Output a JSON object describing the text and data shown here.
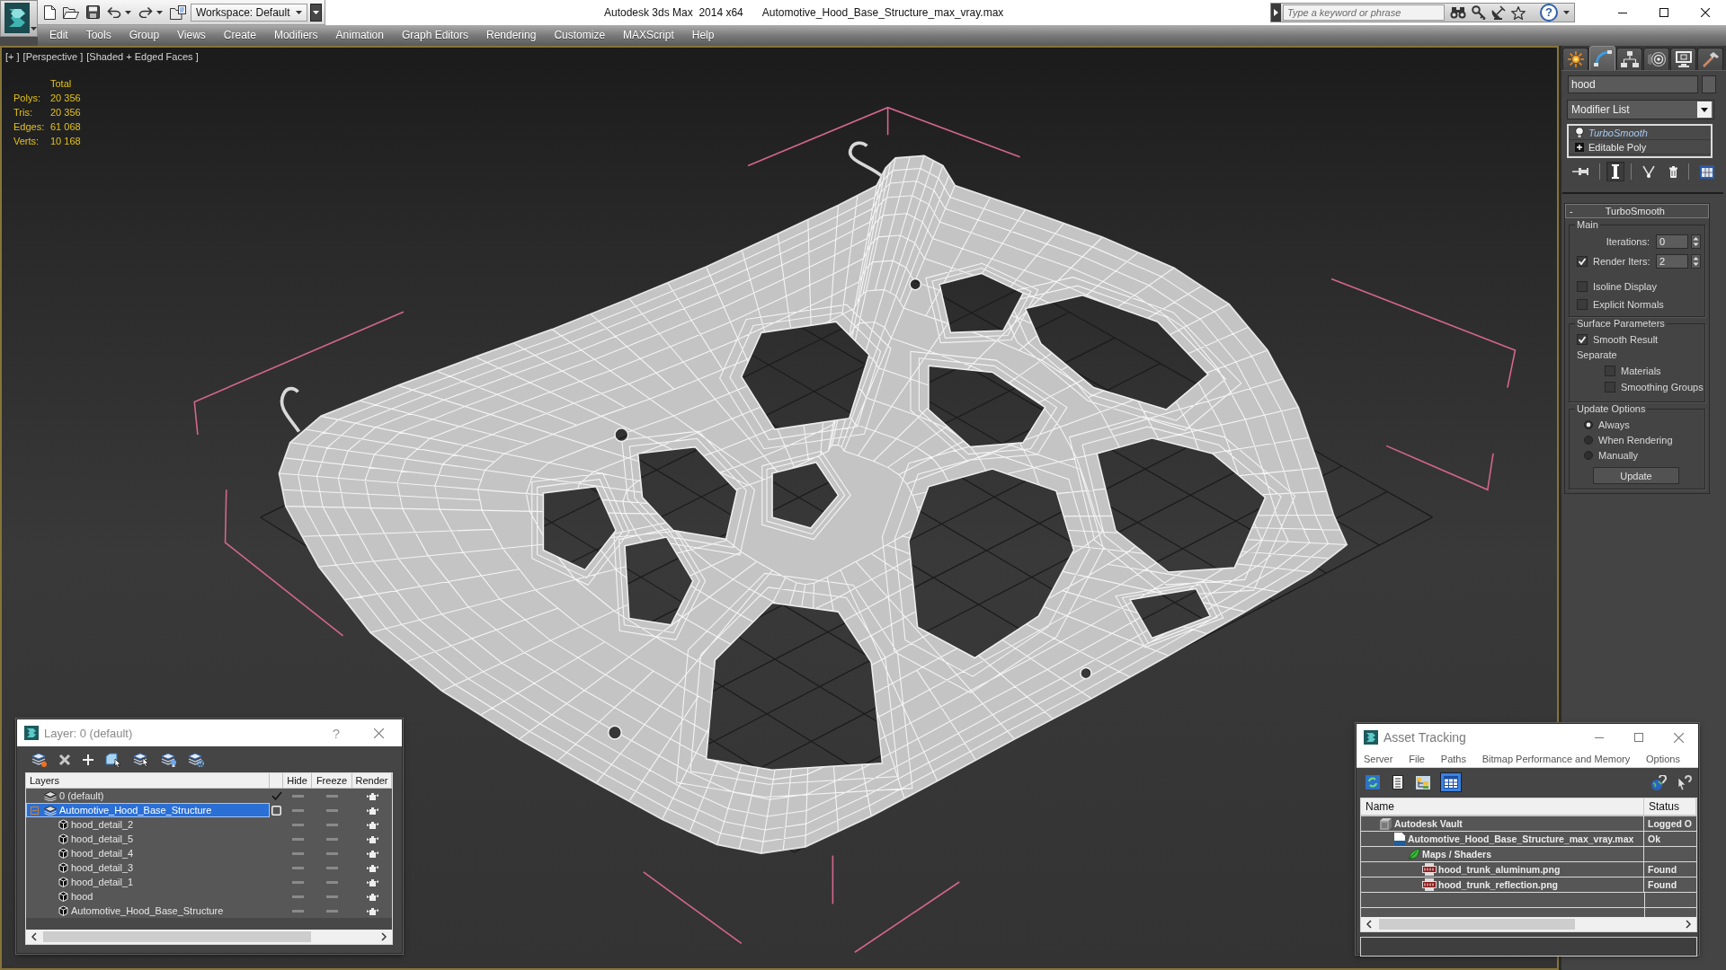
{
  "title_bar": {
    "workspace": "Workspace: Default",
    "app_title": "Autodesk 3ds Max  2014 x64",
    "document": "Automotive_Hood_Base_Structure_max_vray.max",
    "search": {
      "placeholder": "Type a keyword or phrase"
    },
    "help": "?"
  },
  "menu_bar": [
    "Edit",
    "Tools",
    "Group",
    "Views",
    "Create",
    "Modifiers",
    "Animation",
    "Graph Editors",
    "Rendering",
    "Customize",
    "MAXScript",
    "Help"
  ],
  "viewport": {
    "labels": [
      "[+ ]",
      "[Perspective ]",
      "[Shaded + Edged Faces ]"
    ],
    "stats": {
      "heading": "Total",
      "rows": [
        {
          "label": "Polys:",
          "value": "20 356"
        },
        {
          "label": "Tris:",
          "value": "20 356"
        },
        {
          "label": "Edges:",
          "value": "61 068"
        },
        {
          "label": "Verts:",
          "value": "10 168"
        }
      ]
    }
  },
  "command_panel": {
    "tabs": [
      {
        "selected": false
      },
      {
        "selected": true
      },
      {
        "selected": false
      },
      {
        "selected": false
      },
      {
        "selected": false
      },
      {
        "selected": false
      }
    ],
    "object_name": "hood",
    "modifier_list": "Modifier List",
    "stack": [
      {
        "label": "TurboSmooth",
        "kind": "modifier",
        "selected": true,
        "viewport_enabled": false
      },
      {
        "label": "Editable Poly",
        "kind": "base_object",
        "selected": false,
        "viewport_enabled": true
      }
    ],
    "stack_tools": [
      {
        "on": false
      },
      {
        "on": true
      },
      {
        "on": false
      },
      {
        "on": false
      },
      {
        "on": false
      }
    ],
    "rollout": {
      "toggle": "-",
      "title": "TurboSmooth",
      "groups": [
        {
          "title": "Main",
          "controls": [
            {
              "kind": "spinner",
              "label": "Iterations:",
              "value": "0"
            },
            {
              "kind": "checked_spinner",
              "label": "Render Iters:",
              "checked": true,
              "value": "2"
            },
            {
              "kind": "checkbox",
              "label": "Isoline Display",
              "checked": false
            },
            {
              "kind": "checkbox",
              "label": "Explicit Normals",
              "checked": false
            }
          ]
        },
        {
          "title": "Surface Parameters",
          "controls": [
            {
              "kind": "checkbox",
              "label": "Smooth Result",
              "checked": true
            },
            {
              "kind": "label",
              "label": "Separate",
              "children": [
                {
                  "kind": "checkbox",
                  "label": "Materials",
                  "checked": false
                },
                {
                  "kind": "checkbox",
                  "label": "Smoothing Groups",
                  "checked": false
                }
              ]
            }
          ]
        },
        {
          "title": "Update Options",
          "controls": [
            {
              "kind": "radio",
              "label": "Always",
              "selected": true
            },
            {
              "kind": "radio",
              "label": "When Rendering",
              "selected": false
            },
            {
              "kind": "radio",
              "label": "Manually",
              "selected": false
            },
            {
              "kind": "button",
              "label": "Update"
            }
          ]
        }
      ]
    }
  },
  "layer_dialog": {
    "title": "Layer: 0 (default)",
    "help": "?",
    "columns": [
      "Layers",
      "Hide",
      "Freeze",
      "Render"
    ],
    "rows": [
      {
        "name": "0 (default)",
        "kind": "layer",
        "current": true,
        "selected": false,
        "hidden": false,
        "frozen": false,
        "renderable": true
      },
      {
        "name": "Automotive_Hood_Base_Structure",
        "kind": "layer",
        "current": false,
        "selected": true,
        "expanded": true,
        "hidden": false,
        "frozen": false,
        "renderable": true,
        "children": [
          {
            "name": "hood_detail_2",
            "kind": "object",
            "selected": false,
            "hidden": false,
            "frozen": false,
            "renderable": true
          },
          {
            "name": "hood_detail_5",
            "kind": "object",
            "selected": false,
            "hidden": false,
            "frozen": false,
            "renderable": true
          },
          {
            "name": "hood_detail_4",
            "kind": "object",
            "selected": false,
            "hidden": false,
            "frozen": false,
            "renderable": true
          },
          {
            "name": "hood_detail_3",
            "kind": "object",
            "selected": false,
            "hidden": false,
            "frozen": false,
            "renderable": true
          },
          {
            "name": "hood_detail_1",
            "kind": "object",
            "selected": false,
            "hidden": false,
            "frozen": false,
            "renderable": true
          },
          {
            "name": "hood",
            "kind": "object",
            "selected": false,
            "hidden": false,
            "frozen": false,
            "renderable": true
          },
          {
            "name": "Automotive_Hood_Base_Structure",
            "kind": "object",
            "selected": false,
            "hidden": false,
            "frozen": false,
            "renderable": true
          }
        ]
      }
    ]
  },
  "asset_tracking": {
    "title": "Asset Tracking",
    "menu": [
      "Server",
      "File",
      "Paths",
      "Bitmap Performance and Memory",
      "Options"
    ],
    "toolbar": [
      {
        "on": false
      },
      {
        "on": false
      },
      {
        "on": false
      },
      {
        "on": true
      }
    ],
    "columns": [
      "Name",
      "Status"
    ],
    "rows": [
      {
        "name": "Autodesk Vault",
        "status": "Logged O",
        "kind": "provider",
        "children": [
          {
            "name": "Automotive_Hood_Base_Structure_max_vray.max",
            "status": "Ok",
            "kind": "scene",
            "children": [
              {
                "name": "Maps / Shaders",
                "kind": "group",
                "children": [
                  {
                    "name": "hood_trunk_aluminum.png",
                    "status": "Found",
                    "kind": "bitmap"
                  },
                  {
                    "name": "hood_trunk_reflection.png",
                    "status": "Found",
                    "kind": "bitmap"
                  }
                ]
              }
            ]
          }
        ]
      }
    ]
  }
}
